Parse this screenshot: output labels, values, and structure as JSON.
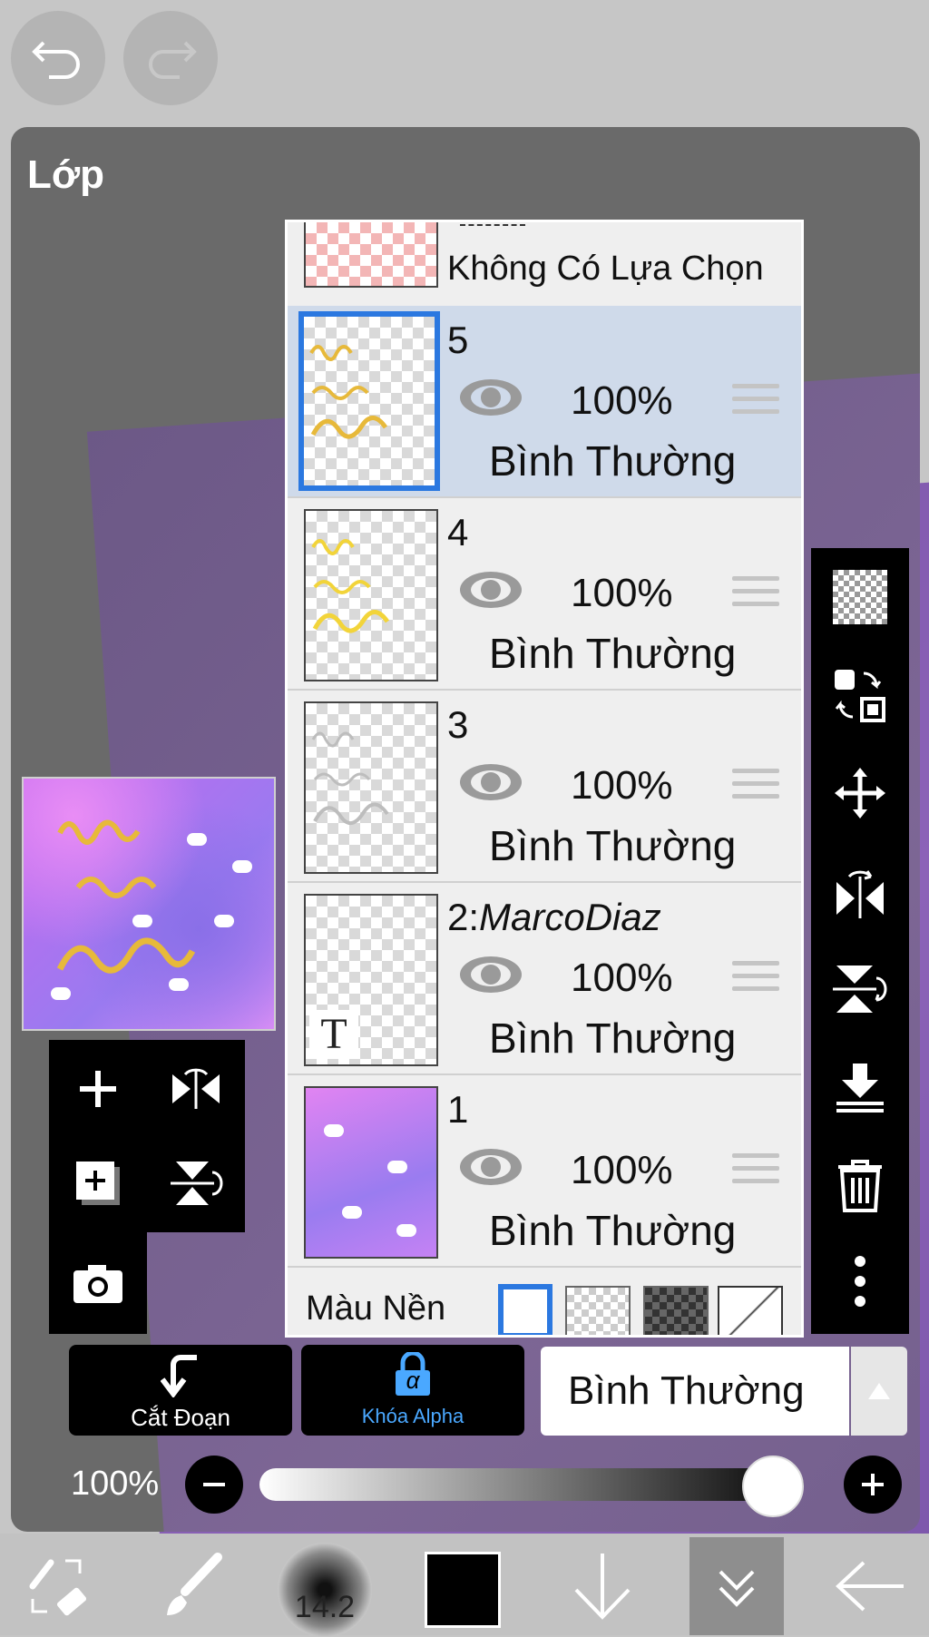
{
  "panel": {
    "title": "Lớp"
  },
  "layers": {
    "top_partial": {
      "label": "Không Có Lựa Chọn"
    },
    "items": [
      {
        "name": "5",
        "opacity": "100%",
        "blend": "Bình Thường",
        "selected": true
      },
      {
        "name": "4",
        "opacity": "100%",
        "blend": "Bình Thường",
        "selected": false
      },
      {
        "name": "3",
        "opacity": "100%",
        "blend": "Bình Thường",
        "selected": false
      },
      {
        "name_prefix": "2:",
        "name_italic": "MarcoDiaz",
        "opacity": "100%",
        "blend": "Bình Thường",
        "selected": false,
        "thumb_text": "T"
      },
      {
        "name": "1",
        "opacity": "100%",
        "blend": "Bình Thường",
        "selected": false
      }
    ],
    "background_label": "Màu Nền"
  },
  "controls": {
    "clip_label": "Cắt Đoạn",
    "alpha_lock_label": "Khóa Alpha",
    "alpha_lock_glyph": "α",
    "blend_mode": "Bình Thường",
    "opacity_label": "100%",
    "opacity_value": 100
  },
  "brush": {
    "size": "14.2"
  },
  "colors": {
    "accent": "#2b78e0",
    "selected_row": "#cfdaea",
    "alpha_text": "#4aa8ff",
    "current_color": "#000000"
  }
}
